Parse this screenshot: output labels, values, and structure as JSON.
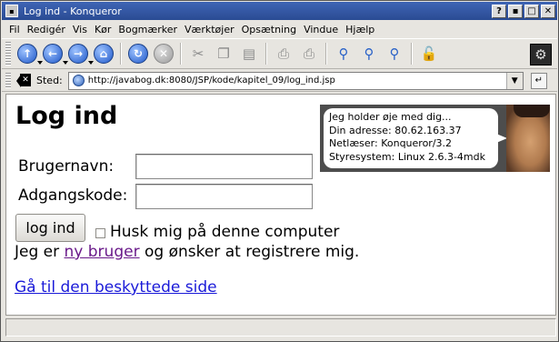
{
  "window": {
    "title": "Log ind - Konqueror",
    "buttons": [
      "?",
      "▪",
      "□",
      "✕"
    ]
  },
  "menu": [
    "Fil",
    "Redigér",
    "Vis",
    "Kør",
    "Bogmærker",
    "Værktøjer",
    "Opsætning",
    "Vindue",
    "Hjælp"
  ],
  "toolbar": {
    "icons": [
      "up-arrow-icon",
      "back-arrow-icon",
      "forward-arrow-icon",
      "home-icon",
      "reload-icon",
      "stop-icon",
      "cut-icon",
      "copy-icon",
      "paste-icon",
      "print-icon",
      "print-frame-icon",
      "zoom-icon",
      "zoom-in-icon",
      "zoom-out-icon",
      "lock-icon",
      "gear-icon"
    ]
  },
  "location": {
    "label": "Sted:",
    "url": "http://javabog.dk:8080/JSP/kode/kapitel_09/log_ind.jsp"
  },
  "page": {
    "heading": "Log ind",
    "username_label": "Brugernavn:",
    "username_value": "",
    "password_label": "Adgangskode:",
    "password_value": "",
    "login_button": "log ind",
    "remember_label": "Husk mig på denne computer",
    "register_prefix": "Jeg er",
    "register_link": "ny bruger",
    "register_suffix": "og ønsker at registrere mig.",
    "protected_link": "Gå til den beskyttede side",
    "info": {
      "line1": "Jeg holder øje med dig...",
      "line2": "Din adresse: 80.62.163.37",
      "line3": "Netlæser: Konqueror/3.2",
      "line4": "Styresystem: Linux 2.6.3-4mdk"
    }
  },
  "status": ""
}
